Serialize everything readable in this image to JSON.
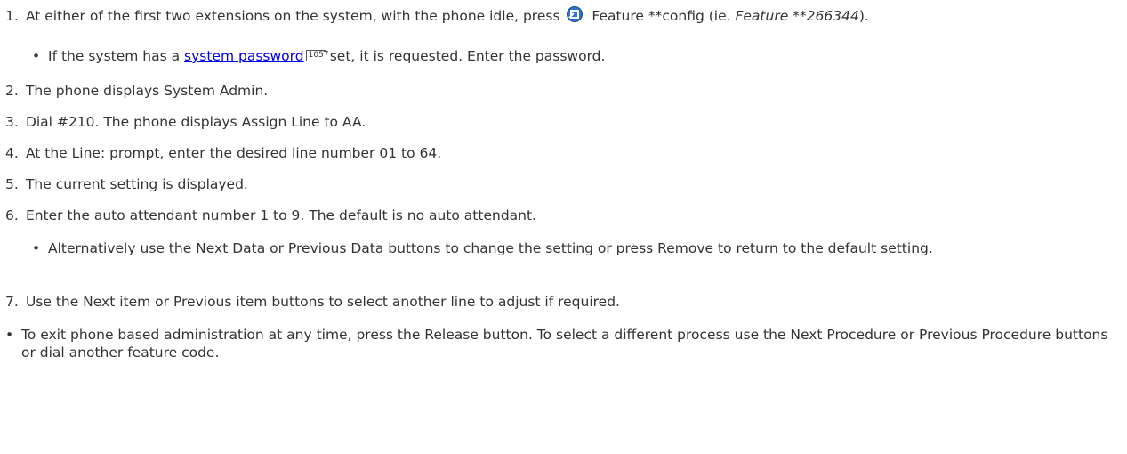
{
  "steps": [
    {
      "num": "1.",
      "pre": "At either of the first two extensions on the system, with the phone idle, press ",
      "post": " Feature **config (ie. ",
      "italic": "Feature **266344",
      "end": ")."
    },
    {
      "num": "2.",
      "text": "The phone displays System Admin."
    },
    {
      "num": "3.",
      "text": "Dial #210. The phone displays Assign Line to AA."
    },
    {
      "num": "4.",
      "text": "At the Line: prompt, enter the desired line number 01 to 64."
    },
    {
      "num": "5.",
      "text": "The current setting is displayed."
    },
    {
      "num": "6.",
      "text": "Enter the auto attendant number 1 to 9. The default is no auto attendant."
    },
    {
      "num": "7.",
      "text": "Use the Next item or Previous item buttons to select another line to adjust if required."
    }
  ],
  "sub1": {
    "bullet": "•",
    "pre": "If the system has a ",
    "link": "system password",
    "page_ref": "105",
    "post": " set, it is requested. Enter the password."
  },
  "sub6": {
    "bullet": "•",
    "text": "Alternatively use the Next Data or Previous Data buttons to change the setting or press Remove to return to the default setting."
  },
  "final_bullet": {
    "bullet": "•",
    "text": "To exit phone based administration at any time, press the Release button. To select a different process use the Next Procedure or Previous Procedure buttons or dial another feature code."
  },
  "icons": {
    "feature_icon": "feature-key-icon",
    "page_ref_icon": "page-reference-icon"
  },
  "colors": {
    "text": "#333333",
    "link": "#0000ee",
    "icon": "#1f6fbf"
  }
}
